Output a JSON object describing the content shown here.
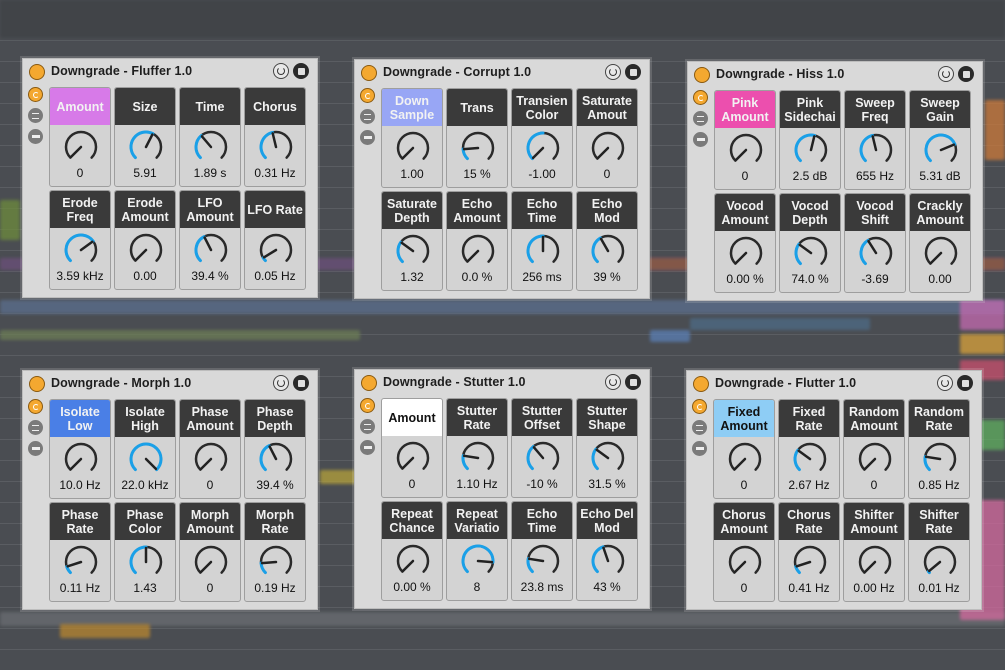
{
  "colors": {
    "arc": "#1aa0e8",
    "knob_ring": "#2a2a2a"
  },
  "devices": [
    {
      "title": "Downgrade - Fluffer 1.0",
      "params": [
        {
          "label": "Amount",
          "value": "0",
          "level": 0,
          "label_bg": "#d77ae8",
          "dark_text": false
        },
        {
          "label": "Size",
          "value": "5.91",
          "level": 0.6
        },
        {
          "label": "Time",
          "value": "1.89 s",
          "level": 0.35
        },
        {
          "label": "Chorus",
          "value": "0.31 Hz",
          "level": 0.45
        },
        {
          "label": "Erode\nFreq",
          "value": "3.59 kHz",
          "level": 0.7
        },
        {
          "label": "Erode\nAmount",
          "value": "0.00",
          "level": 0
        },
        {
          "label": "LFO\nAmount",
          "value": "39.4 %",
          "level": 0.4
        },
        {
          "label": "LFO Rate",
          "value": "0.05 Hz",
          "level": 0.05
        }
      ]
    },
    {
      "title": "Downgrade - Corrupt 1.0",
      "params": [
        {
          "label": "Down\nSample",
          "value": "1.00",
          "level": 0,
          "label_bg": "#98a6f5",
          "dark_text": false
        },
        {
          "label": "Trans",
          "value": "15 %",
          "level": 0.15
        },
        {
          "label": "Transien\nColor",
          "value": "-1.00",
          "level": 0,
          "centered": true
        },
        {
          "label": "Saturate\nAmout",
          "value": "0",
          "level": 0
        },
        {
          "label": "Saturate\nDepth",
          "value": "1.32",
          "level": 0.3
        },
        {
          "label": "Echo\nAmount",
          "value": "0.0 %",
          "level": 0
        },
        {
          "label": "Echo\nTime",
          "value": "256 ms",
          "level": 0.5
        },
        {
          "label": "Echo\nMod",
          "value": "39 %",
          "level": 0.39
        }
      ]
    },
    {
      "title": "Downgrade - Hiss 1.0",
      "params": [
        {
          "label": "Pink\nAmount",
          "value": "0",
          "level": 0,
          "label_bg": "#ec4fae",
          "dark_text": false
        },
        {
          "label": "Pink\nSidechai",
          "value": "2.5 dB",
          "level": 0.55
        },
        {
          "label": "Sweep\nFreq",
          "value": "655 Hz",
          "level": 0.45
        },
        {
          "label": "Sweep\nGain",
          "value": "5.31 dB",
          "level": 0.75
        },
        {
          "label": "Vocod\nAmount",
          "value": "0.00 %",
          "level": 0
        },
        {
          "label": "Vocod\nDepth",
          "value": "74.0 %",
          "level": 0.3
        },
        {
          "label": "Vocod\nShift",
          "value": "-3.69",
          "level": 0.38
        },
        {
          "label": "Crackly\nAmount",
          "value": "0.00",
          "level": 0
        }
      ]
    },
    {
      "title": "Downgrade - Morph 1.0",
      "params": [
        {
          "label": "Isolate\nLow",
          "value": "10.0 Hz",
          "level": 0,
          "label_bg": "#4a7fe6",
          "dark_text": false
        },
        {
          "label": "Isolate\nHigh",
          "value": "22.0 kHz",
          "level": 1
        },
        {
          "label": "Phase\nAmount",
          "value": "0",
          "level": 0
        },
        {
          "label": "Phase\nDepth",
          "value": "39.4 %",
          "level": 0.4
        },
        {
          "label": "Phase\nRate",
          "value": "0.11 Hz",
          "level": 0.1
        },
        {
          "label": "Phase\nColor",
          "value": "1.43",
          "level": 0.5
        },
        {
          "label": "Morph\nAmount",
          "value": "0",
          "level": 0
        },
        {
          "label": "Morph\nRate",
          "value": "0.19 Hz",
          "level": 0.15
        }
      ]
    },
    {
      "title": "Downgrade - Stutter 1.0",
      "params": [
        {
          "label": "Amount",
          "value": "0",
          "level": 0,
          "label_bg": "#ffffff",
          "dark_text": true
        },
        {
          "label": "Stutter\nRate",
          "value": "1.10 Hz",
          "level": 0.2
        },
        {
          "label": "Stutter\nOffset",
          "value": "-10 %",
          "level": 0.35
        },
        {
          "label": "Stutter\nShape",
          "value": "31.5 %",
          "level": 0.3
        },
        {
          "label": "Repeat\nChance",
          "value": "0.00 %",
          "level": 0
        },
        {
          "label": "Repeat\nVariatio",
          "value": "8",
          "level": 0.85
        },
        {
          "label": "Echo\nTime",
          "value": "23.8 ms",
          "level": 0.2
        },
        {
          "label": "Echo Del\nMod",
          "value": "43 %",
          "level": 0.43
        }
      ]
    },
    {
      "title": "Downgrade - Flutter 1.0",
      "params": [
        {
          "label": "Fixed\nAmount",
          "value": "0",
          "level": 0,
          "label_bg": "#8ecdf5",
          "dark_text": true
        },
        {
          "label": "Fixed\nRate",
          "value": "2.67 Hz",
          "level": 0.3
        },
        {
          "label": "Random\nAmount",
          "value": "0",
          "level": 0
        },
        {
          "label": "Random\nRate",
          "value": "0.85 Hz",
          "level": 0.2
        },
        {
          "label": "Chorus\nAmount",
          "value": "0",
          "level": 0
        },
        {
          "label": "Chorus\nRate",
          "value": "0.41 Hz",
          "level": 0.1
        },
        {
          "label": "Shifter\nAmount",
          "value": "0.00 Hz",
          "level": 0
        },
        {
          "label": "Shifter\nRate",
          "value": "0.01 Hz",
          "level": 0.02
        }
      ]
    }
  ]
}
